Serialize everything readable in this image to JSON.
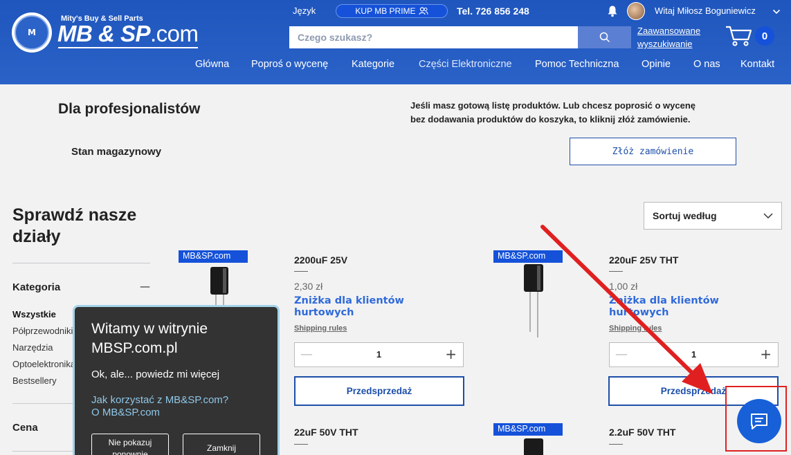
{
  "header": {
    "logo_tagline": "Mity's Buy & Sell Parts",
    "logo_main": "MB & SP",
    "logo_suffix": ".com",
    "logo_badge_text": "M",
    "language_label": "Język",
    "prime_button": "KUP MB PRIME",
    "phone": "Tel. 726 856 248",
    "user_greeting": "Witaj Miłosz Boguniewicz",
    "search_placeholder": "Czego szukasz?",
    "advanced_search_line1": "Zaawansowane",
    "advanced_search_line2": "wyszukiwanie",
    "cart_count": "0",
    "nav": [
      "Główna",
      "Poproś o wycenę",
      "Kategorie",
      "Części Elektroniczne",
      "Pomoc Techniczna",
      "Opinie",
      "O nas",
      "Kontakt"
    ]
  },
  "pro": {
    "title": "Dla profesjonalistów",
    "stock_label": "Stan magazynowy",
    "text_line1": "Jeśli masz gotową listę produktów. Lub chcesz poprosić o wycenę",
    "text_line2": "bez dodawania produktów do koszyka, to kliknij złóż zamówienie.",
    "order_button": "Złóż zamówienie"
  },
  "sidebar": {
    "title_line1": "Sprawdź nasze",
    "title_line2": "działy",
    "category_heading": "Kategoria",
    "category_toggle": "—",
    "categories": [
      "Wszystkie",
      "Półprzewodniki",
      "Narzędzia",
      "Optoelektronika",
      "Bestsellery"
    ],
    "price_heading": "Cena"
  },
  "sort": {
    "label": "Sortuj według"
  },
  "products": [
    {
      "badge": "MB&SP.com",
      "name": "2200uF 25V",
      "price": "2,30 zł",
      "discount_line1": "Zniżka dla klientów",
      "discount_line2": "hurtowych",
      "shipping": "Shipping rules",
      "quantity": "1",
      "button": "Przedsprzedaż"
    },
    {
      "badge": "MB&SP.com",
      "name": "220uF 25V THT",
      "price": "1,00 zł",
      "discount_line1": "Zniżka dla klientów",
      "discount_line2": "hurtowych",
      "shipping": "Shipping rules",
      "quantity": "1",
      "button": "Przedsprzedaż"
    },
    {
      "name": "22uF 50V THT"
    },
    {
      "badge": "MB&SP.com",
      "name": "2.2uF 50V THT"
    }
  ],
  "popup": {
    "title_line1": "Witamy w witrynie",
    "title_line2": "MBSP.com.pl",
    "subtitle": "Ok, ale... powiedz mi więcej",
    "link_line1": "Jak korzystać z MB&SP.com?",
    "link_line2": "O MB&SP.com",
    "btn_dont_show_line1": "Nie pokazuj",
    "btn_dont_show_line2": "ponownie",
    "btn_close": "Zamknij"
  },
  "colors": {
    "header_blue": "#2a62c8",
    "accent_blue": "#1552d9",
    "link_blue": "#2f6ad9",
    "annotation_red": "#e02020"
  },
  "icons": [
    "user-group-icon",
    "bell-icon",
    "search-icon",
    "cart-icon",
    "chevron-down-icon",
    "minus-icon",
    "plus-icon",
    "chat-icon"
  ]
}
